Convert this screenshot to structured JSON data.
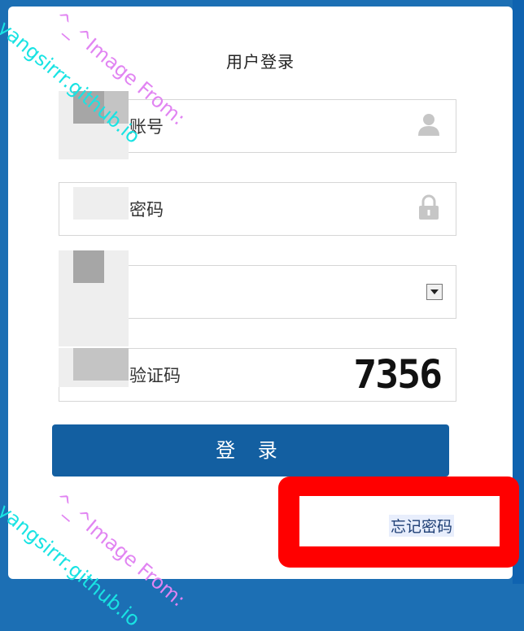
{
  "title": "用户登录",
  "fields": {
    "account": {
      "label": "账号",
      "icon": "user-icon"
    },
    "password": {
      "label": "密码",
      "icon": "lock-icon"
    },
    "select": {
      "value": "",
      "icon": "dropdown-arrow-icon"
    },
    "captcha": {
      "label": "验证码",
      "code": "7356"
    }
  },
  "login_button": "登 录",
  "forgot_link": "忘记密码",
  "watermark": {
    "line1": "^_^Image From:",
    "line2": "yangsirrr.github.io"
  },
  "colors": {
    "background": "#1c6fb4",
    "button": "#135fa1",
    "highlight": "#ff0000",
    "link": "#1e3f75"
  }
}
